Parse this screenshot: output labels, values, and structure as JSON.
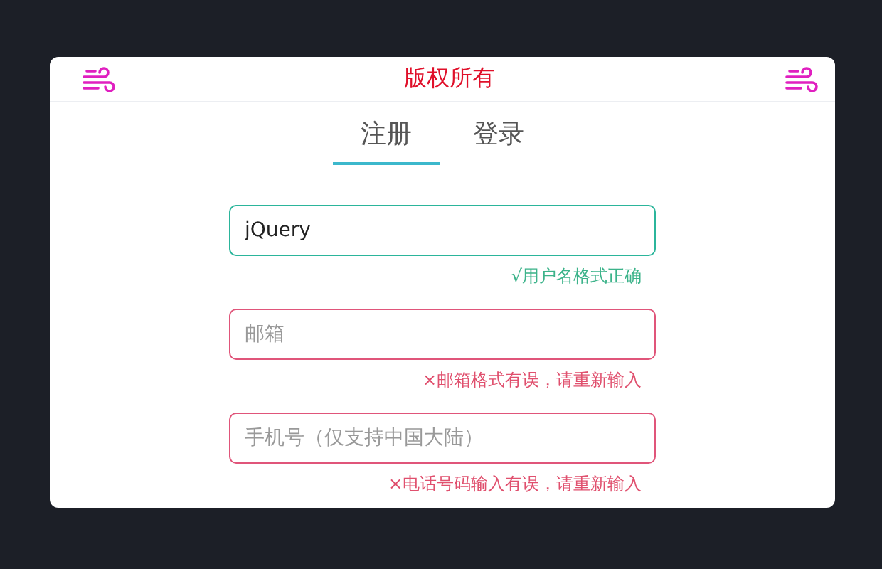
{
  "header": {
    "title": "版权所有"
  },
  "tabs": [
    {
      "label": "注册",
      "selected": true
    },
    {
      "label": "登录",
      "selected": false
    }
  ],
  "fields": [
    {
      "value": "jQuery",
      "valid": true,
      "message": "√用户名格式正确"
    },
    {
      "placeholder": "邮箱",
      "valid": false,
      "message": "×邮箱格式有误，请重新输入"
    },
    {
      "placeholder": "手机号（仅支持中国大陆）",
      "valid": false,
      "message": "×电话号码输入有误，请重新输入"
    }
  ]
}
